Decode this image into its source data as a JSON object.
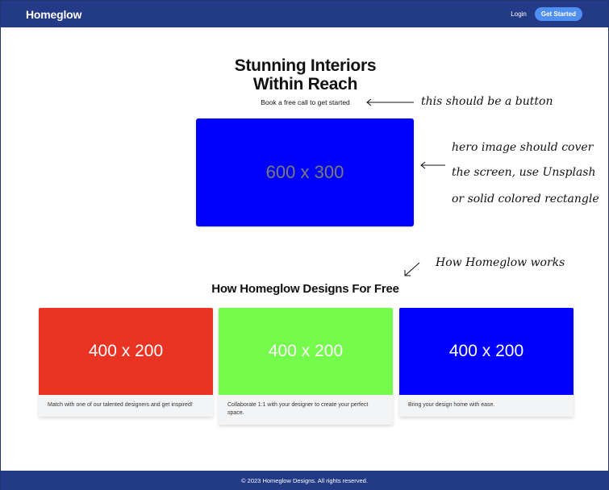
{
  "nav": {
    "brand": "Homeglow",
    "login": "Login",
    "cta": "Get Started"
  },
  "hero": {
    "title_line1": "Stunning Interiors",
    "title_line2": "Within Reach",
    "subtitle": "Book a free call to get started",
    "image_placeholder": "600 x 300",
    "image_color": "#0000ff"
  },
  "annotations": {
    "button_note": "this should be a button",
    "hero_note_1": "hero image should cover",
    "hero_note_2": "the screen, use Unsplash",
    "hero_note_3": "or solid colored rectangle",
    "how_note": "How Homeglow works"
  },
  "section": {
    "title": "How Homeglow Designs For Free"
  },
  "cards": [
    {
      "image_placeholder": "400 x 200",
      "color": "#e93323",
      "text": "Match with one of our talented designers and get inspired!"
    },
    {
      "image_placeholder": "400 x 200",
      "color": "#75fb4c",
      "text": "Collaborate 1:1 with your designer to create your perfect space."
    },
    {
      "image_placeholder": "400 x 200",
      "color": "#0000ff",
      "text": "Bring your design home with ease."
    }
  ],
  "footer": {
    "text": "© 2023 Homeglow Designs. All rights reserved."
  },
  "colors": {
    "navbar": "#233a86",
    "cta": "#4f8ff1"
  }
}
